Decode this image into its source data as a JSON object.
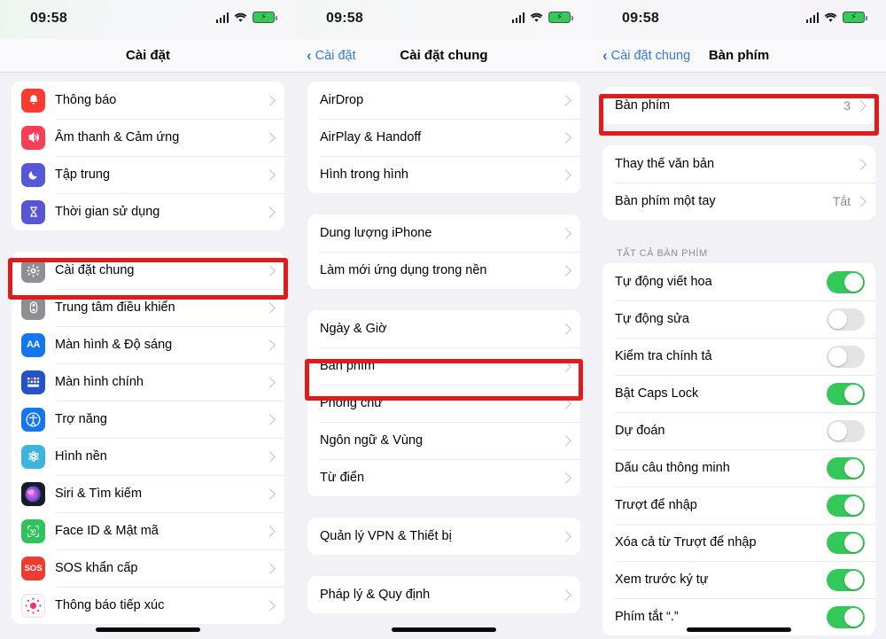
{
  "status": {
    "time": "09:58",
    "signal_icon": "cellular-signal-icon",
    "wifi_icon": "wifi-icon",
    "battery_icon": "battery-charging-icon"
  },
  "panel1": {
    "nav": {
      "title": "Cài đặt"
    },
    "groups": [
      {
        "rows": [
          {
            "label": "Thông báo",
            "icon": "notifications-icon",
            "icon_bg": "#fb3b30"
          },
          {
            "label": "Âm thanh & Cảm ứng",
            "icon": "sounds-haptics-icon",
            "icon_bg": "#f83e56"
          },
          {
            "label": "Tập trung",
            "icon": "focus-icon",
            "icon_bg": "#5758d6"
          },
          {
            "label": "Thời gian sử dụng",
            "icon": "screen-time-icon",
            "icon_bg": "#5756d5"
          }
        ]
      },
      {
        "rows": [
          {
            "label": "Cài đặt chung",
            "icon": "general-gear-icon",
            "icon_bg": "#8e8e93",
            "highlighted": true
          },
          {
            "label": "Trung tâm điều khiển",
            "icon": "control-center-icon",
            "icon_bg": "#8e8e93"
          },
          {
            "label": "Màn hình & Độ sáng",
            "icon": "display-brightness-icon",
            "icon_bg": "#1476f0"
          },
          {
            "label": "Màn hình chính",
            "icon": "home-screen-icon",
            "icon_bg": "#2452c8"
          },
          {
            "label": "Trợ năng",
            "icon": "accessibility-icon",
            "icon_bg": "#1476f0"
          },
          {
            "label": "Hình nền",
            "icon": "wallpaper-icon",
            "icon_bg": "#3cb4dc"
          },
          {
            "label": "Siri & Tìm kiếm",
            "icon": "siri-icon",
            "icon_bg": "#1b1b28"
          },
          {
            "label": "Face ID & Mật mã",
            "icon": "face-id-icon",
            "icon_bg": "#2fc45a"
          },
          {
            "label": "SOS khẩn cấp",
            "icon": "emergency-sos-icon",
            "icon_bg": "#ef3c33"
          },
          {
            "label": "Thông báo tiếp xúc",
            "icon": "exposure-notifications-icon",
            "icon_bg": "#ffffff"
          }
        ]
      }
    ]
  },
  "panel2": {
    "nav": {
      "back": "Cài đặt",
      "title": "Cài đặt chung",
      "back_icon": "chevron-left-icon"
    },
    "groups": [
      {
        "rows": [
          {
            "label": "AirDrop"
          },
          {
            "label": "AirPlay & Handoff"
          },
          {
            "label": "Hình trong hình"
          }
        ]
      },
      {
        "rows": [
          {
            "label": "Dung lượng iPhone"
          },
          {
            "label": "Làm mới ứng dụng trong nền"
          }
        ]
      },
      {
        "rows": [
          {
            "label": "Ngày & Giờ"
          },
          {
            "label": "Bàn phím",
            "highlighted": true
          },
          {
            "label": "Phông chữ"
          },
          {
            "label": "Ngôn ngữ & Vùng"
          },
          {
            "label": "Từ điển"
          }
        ]
      },
      {
        "rows": [
          {
            "label": "Quản lý VPN & Thiết bị"
          }
        ]
      },
      {
        "rows": [
          {
            "label": "Pháp lý & Quy định"
          }
        ]
      }
    ]
  },
  "panel3": {
    "nav": {
      "back": "Cài đặt chung",
      "title": "Bàn phím",
      "back_icon": "chevron-left-icon"
    },
    "groups": [
      {
        "rows": [
          {
            "label": "Bàn phím",
            "value": "3",
            "highlighted": true
          }
        ]
      },
      {
        "rows": [
          {
            "label": "Thay thế văn bản"
          },
          {
            "label": "Bàn phím một tay",
            "value": "Tắt"
          }
        ]
      }
    ],
    "section_header": "TẤT CẢ BÀN PHÍM",
    "toggle_rows": [
      {
        "label": "Tự động viết hoa",
        "on": true
      },
      {
        "label": "Tự động sửa",
        "on": false
      },
      {
        "label": "Kiểm tra chính tả",
        "on": false
      },
      {
        "label": "Bật Caps Lock",
        "on": true
      },
      {
        "label": "Dự đoán",
        "on": false
      },
      {
        "label": "Dấu câu thông minh",
        "on": true
      },
      {
        "label": "Trượt để nhập",
        "on": true
      },
      {
        "label": "Xóa cả từ Trượt để nhập",
        "on": true
      },
      {
        "label": "Xem trước ký tự",
        "on": true
      },
      {
        "label": "Phím tắt “.”",
        "on": true
      }
    ]
  },
  "colors": {
    "highlight": "#e01b1b",
    "toggle_on": "#34c759",
    "accent_blue": "#3379d6"
  }
}
